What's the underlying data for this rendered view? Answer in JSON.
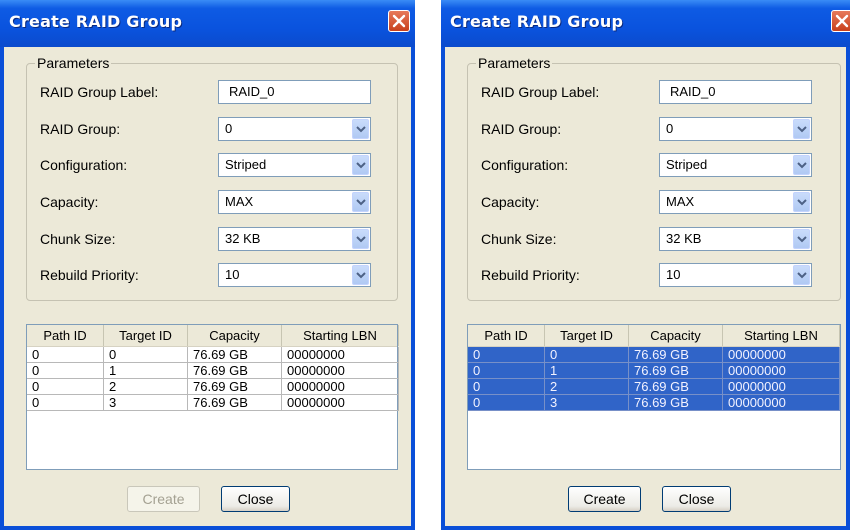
{
  "dialogs": [
    {
      "title": "Create RAID Group",
      "group_title": "Parameters",
      "fields": [
        {
          "label": "RAID Group Label:",
          "value": "RAID_0"
        },
        {
          "label": "RAID Group:",
          "value": "0"
        },
        {
          "label": "Configuration:",
          "value": "Striped"
        },
        {
          "label": "Capacity:",
          "value": "MAX"
        },
        {
          "label": "Chunk Size:",
          "value": "32 KB"
        },
        {
          "label": "Rebuild Priority:",
          "value": "10"
        }
      ],
      "table": {
        "columns": [
          "Path ID",
          "Target ID",
          "Capacity",
          "Starting LBN"
        ],
        "rows": [
          [
            "0",
            "0",
            "76.69 GB",
            "00000000"
          ],
          [
            "0",
            "1",
            "76.69 GB",
            "00000000"
          ],
          [
            "0",
            "2",
            "76.69 GB",
            "00000000"
          ],
          [
            "0",
            "3",
            "76.69 GB",
            "00000000"
          ]
        ],
        "rows_selected": false
      },
      "buttons": {
        "create": "Create",
        "close": "Close",
        "create_enabled": false
      }
    },
    {
      "title": "Create RAID Group",
      "group_title": "Parameters",
      "fields": [
        {
          "label": "RAID Group Label:",
          "value": "RAID_0"
        },
        {
          "label": "RAID Group:",
          "value": "0"
        },
        {
          "label": "Configuration:",
          "value": "Striped"
        },
        {
          "label": "Capacity:",
          "value": "MAX"
        },
        {
          "label": "Chunk Size:",
          "value": "32 KB"
        },
        {
          "label": "Rebuild Priority:",
          "value": "10"
        }
      ],
      "table": {
        "columns": [
          "Path ID",
          "Target ID",
          "Capacity",
          "Starting LBN"
        ],
        "rows": [
          [
            "0",
            "0",
            "76.69 GB",
            "00000000"
          ],
          [
            "0",
            "1",
            "76.69 GB",
            "00000000"
          ],
          [
            "0",
            "2",
            "76.69 GB",
            "00000000"
          ],
          [
            "0",
            "3",
            "76.69 GB",
            "00000000"
          ]
        ],
        "rows_selected": true
      },
      "buttons": {
        "create": "Create",
        "close": "Close",
        "create_enabled": true
      }
    }
  ],
  "colors": {
    "window_frame": "#0a4fd8",
    "dialog_face": "#ece9d8",
    "selection": "#3064c8"
  }
}
